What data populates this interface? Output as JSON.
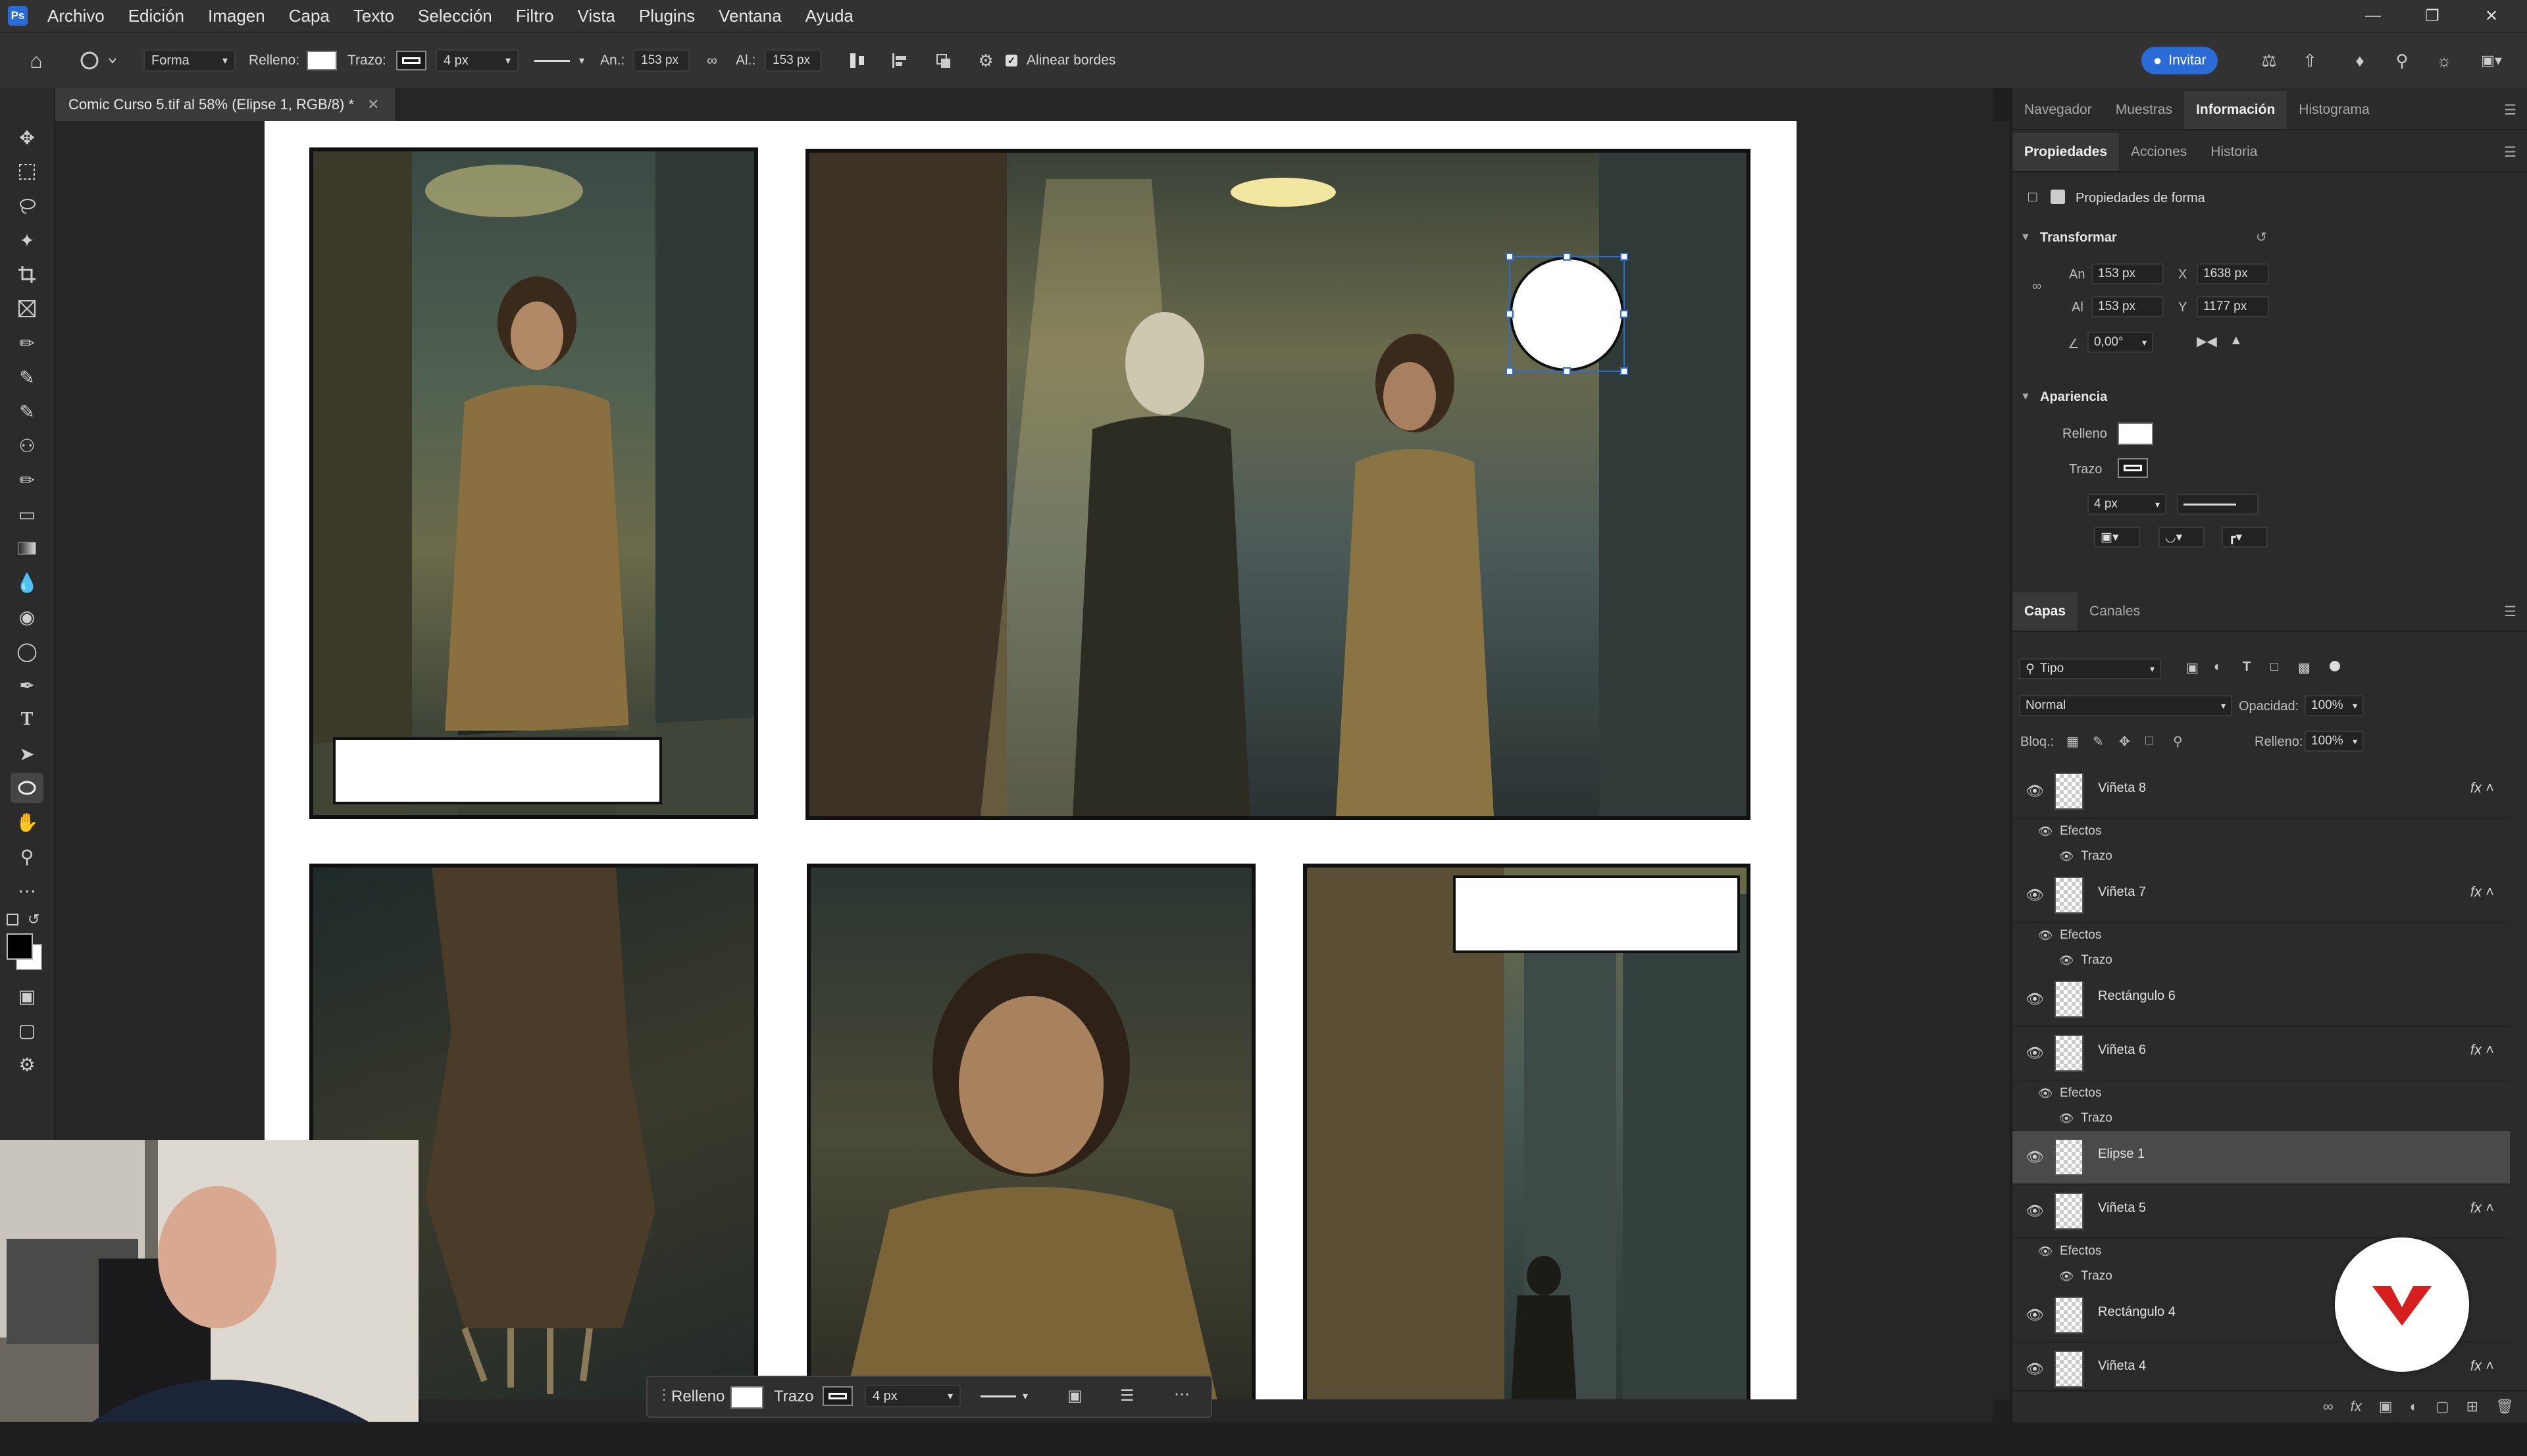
{
  "app": {
    "menu": [
      "Archivo",
      "Edición",
      "Imagen",
      "Capa",
      "Texto",
      "Selección",
      "Filtro",
      "Vista",
      "Plugins",
      "Ventana",
      "Ayuda"
    ],
    "logo_text": "Ps"
  },
  "optbar": {
    "mode": "Forma",
    "fill_label": "Relleno:",
    "stroke_label": "Trazo:",
    "stroke_width": "4 px",
    "w_label": "An.:",
    "w_value": "153 px",
    "h_label": "Al.:",
    "h_value": "153 px",
    "align_edges": "Alinear bordes",
    "invite": "Invitar"
  },
  "document": {
    "tab_title": "Comic Curso 5.tif al 58% (Elipse 1, RGB/8) *"
  },
  "right": {
    "top_tabs": [
      "Navegador",
      "Muestras",
      "Información",
      "Histograma"
    ],
    "top_active": 2,
    "prop_tabs": [
      "Propiedades",
      "Acciones",
      "Historia"
    ],
    "prop_active": 0,
    "shape_props": "Propiedades de forma",
    "transform_title": "Transformar",
    "an_label": "An",
    "an_value": "153 px",
    "x_label": "X",
    "x_value": "1638 px",
    "al_label": "Al",
    "al_value": "153 px",
    "y_label": "Y",
    "y_value": "1177 px",
    "angle_value": "0,00°",
    "appearance_title": "Apariencia",
    "fill_label": "Relleno",
    "stroke_label": "Trazo",
    "stroke_width": "4 px",
    "layer_tabs": [
      "Capas",
      "Canales"
    ],
    "layer_active": 0,
    "filter_kind": "Tipo",
    "blend_mode": "Normal",
    "opacity_label": "Opacidad:",
    "opacity_value": "100%",
    "lock_label": "Bloq.:",
    "fill2_label": "Relleno:",
    "fill2_value": "100%",
    "effects_label": "Efectos",
    "stroke_effect_label": "Trazo",
    "layers": [
      {
        "name": "Viñeta 8",
        "fx": true
      },
      {
        "name": "Viñeta 7",
        "fx": true
      },
      {
        "name": "Rectángulo 6",
        "fx": false
      },
      {
        "name": "Viñeta 6",
        "fx": true
      },
      {
        "name": "Elipse 1",
        "fx": false,
        "selected": true
      },
      {
        "name": "Viñeta 5",
        "fx": true
      },
      {
        "name": "Rectángulo 4",
        "fx": false
      },
      {
        "name": "Viñeta 4",
        "fx": true
      }
    ]
  },
  "ctxbar": {
    "fill_label": "Relleno",
    "stroke_label": "Trazo",
    "stroke_width": "4 px"
  },
  "colors": {
    "accent": "#2b6bd6",
    "selected_layer": "#4a4a4a",
    "badge_red": "#d62020"
  }
}
